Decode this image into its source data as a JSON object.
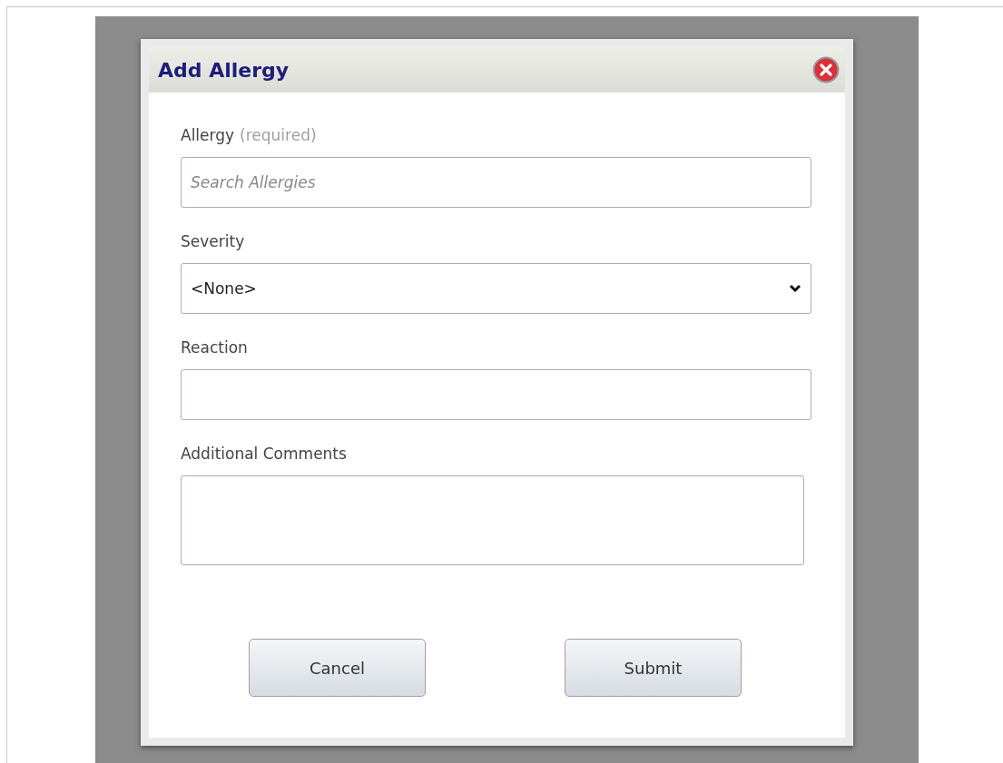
{
  "dialog": {
    "title": "Add Allergy"
  },
  "fields": [
    {
      "kind": "search",
      "label": "Allergy",
      "hint": "(required)",
      "placeholder": "Search Allergies"
    },
    {
      "kind": "select",
      "label": "Severity",
      "value": "<None>"
    },
    {
      "kind": "text",
      "label": "Reaction"
    },
    {
      "kind": "textarea",
      "label": "Additional Comments"
    }
  ],
  "buttons": [
    "Cancel",
    "Submit"
  ]
}
